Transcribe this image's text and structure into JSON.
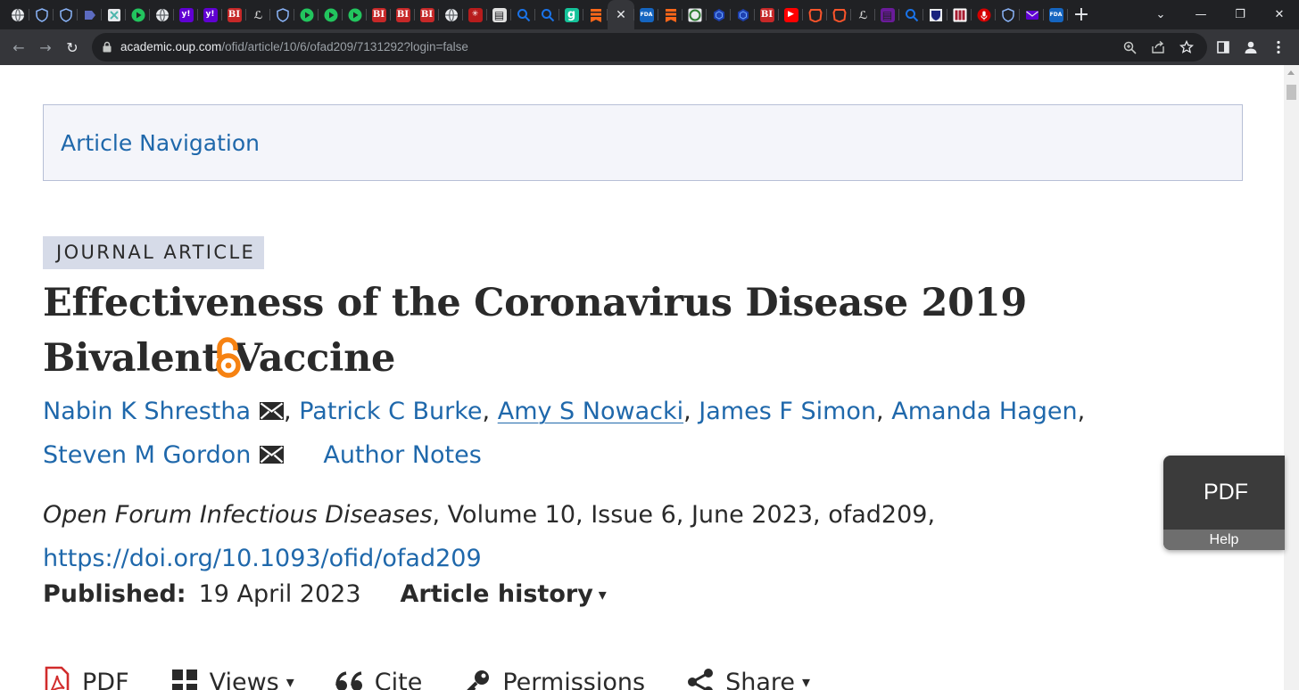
{
  "browser": {
    "tabs": [
      {
        "icon": "globe-icon",
        "label": "",
        "color": "#5f6368"
      },
      {
        "icon": "shield-icon",
        "label": "",
        "color": "#1a73e8"
      },
      {
        "icon": "shield-icon",
        "label": "",
        "color": "#1a73e8"
      },
      {
        "icon": "tag-icon",
        "label": "",
        "color": "#5c6bc0"
      },
      {
        "icon": "app-icon",
        "label": "",
        "color": "#4db6ac"
      },
      {
        "icon": "play-icon",
        "label": "",
        "color": "#22c55e"
      },
      {
        "icon": "globe-icon",
        "label": "",
        "color": "#5f6368"
      },
      {
        "icon": "yahoo-icon",
        "label": "y!",
        "color": "#6001d2"
      },
      {
        "icon": "yahoo-icon",
        "label": "y!",
        "color": "#6001d2"
      },
      {
        "icon": "bi-icon",
        "label": "BI",
        "color": "#c62828"
      },
      {
        "icon": "text-icon",
        "label": "ℒ",
        "color": "#444444"
      },
      {
        "icon": "shield-icon",
        "label": "",
        "color": "#1a73e8"
      },
      {
        "icon": "play-icon",
        "label": "",
        "color": "#22c55e"
      },
      {
        "icon": "play-icon",
        "label": "",
        "color": "#22c55e"
      },
      {
        "icon": "play-icon",
        "label": "",
        "color": "#22c55e"
      },
      {
        "icon": "bi-icon",
        "label": "BI",
        "color": "#c62828"
      },
      {
        "icon": "bi-icon",
        "label": "BI",
        "color": "#c62828"
      },
      {
        "icon": "bi-icon",
        "label": "BI",
        "color": "#c62828"
      },
      {
        "icon": "globe-icon",
        "label": "",
        "color": "#5f6368"
      },
      {
        "icon": "burst-icon",
        "label": "✳",
        "color": "#b71c1c"
      },
      {
        "icon": "news-icon",
        "label": "▤",
        "color": "#e0e0e0"
      },
      {
        "icon": "search-icon",
        "label": "",
        "color": "#1a73e8"
      },
      {
        "icon": "search-icon",
        "label": "",
        "color": "#1a73e8"
      },
      {
        "icon": "g-icon",
        "label": "g",
        "color": "#15c39a"
      },
      {
        "icon": "bookmark-icon",
        "label": "",
        "color": "#ff6719"
      },
      {
        "icon": "close-icon",
        "label": "✕",
        "color": "#e8eaed",
        "active": true
      },
      {
        "icon": "fda-icon",
        "label": "FDA",
        "color": "#1565c0"
      },
      {
        "icon": "bookmark-icon",
        "label": "",
        "color": "#ff6719"
      },
      {
        "icon": "seal-icon",
        "label": "",
        "color": "#2e7d32"
      },
      {
        "icon": "hex-icon",
        "label": "",
        "color": "#1e40af"
      },
      {
        "icon": "hex-icon",
        "label": "",
        "color": "#1e40af"
      },
      {
        "icon": "bi-icon",
        "label": "BI",
        "color": "#c62828"
      },
      {
        "icon": "youtube-icon",
        "label": "▶",
        "color": "#ff0000"
      },
      {
        "icon": "brave-icon",
        "label": "",
        "color": "#fb542b"
      },
      {
        "icon": "brave-icon",
        "label": "",
        "color": "#fb542b"
      },
      {
        "icon": "text-icon",
        "label": "ℒ",
        "color": "#444444"
      },
      {
        "icon": "news-icon",
        "label": "▤",
        "color": "#6a1b9a"
      },
      {
        "icon": "search-icon",
        "label": "",
        "color": "#1a73e8"
      },
      {
        "icon": "shield-crest-icon",
        "label": "",
        "color": "#1a237e"
      },
      {
        "icon": "harvard-icon",
        "label": "",
        "color": "#a51c30"
      },
      {
        "icon": "mic-icon",
        "label": "",
        "color": "#d50000"
      },
      {
        "icon": "shield-icon",
        "label": "",
        "color": "#1a73e8"
      },
      {
        "icon": "mail-icon",
        "label": "",
        "color": "#6001d2"
      },
      {
        "icon": "fda-icon",
        "label": "FDA",
        "color": "#1565c0"
      }
    ],
    "new_tab": "+",
    "window_controls": {
      "dropdown": "⌄",
      "minimize": "—",
      "restore": "❐",
      "close": "✕"
    },
    "back": "←",
    "forward": "→",
    "reload": "↻",
    "url_host": "academic.oup.com",
    "url_path": "/ofid/article/10/6/ofad209/7131292?login=false",
    "omni_icons": [
      "zoom-icon",
      "share-icon",
      "star-icon"
    ],
    "toolbar_icons": [
      "sidepanel-icon",
      "profile-icon",
      "menu-icon"
    ]
  },
  "article_nav": {
    "label": "Article Navigation"
  },
  "badge": "JOURNAL ARTICLE",
  "title": "Effectiveness of the Coronavirus Disease 2019 Bivalent Vaccine",
  "open_access_color": "#f68212",
  "authors": [
    {
      "name": "Nabin K Shrestha",
      "email": true,
      "underline": false
    },
    {
      "name": "Patrick C Burke",
      "email": false,
      "underline": false
    },
    {
      "name": "Amy S Nowacki",
      "email": false,
      "underline": true
    },
    {
      "name": "James F Simon",
      "email": false,
      "underline": false
    },
    {
      "name": "Amanda Hagen",
      "email": false,
      "underline": false
    },
    {
      "name": "Steven M Gordon",
      "email": true,
      "underline": false
    }
  ],
  "author_notes": "Author Notes",
  "citation": {
    "journal": "Open Forum Infectious Diseases",
    "details": ", Volume 10, Issue 6, June 2023, ofad209,",
    "doi": "https://doi.org/10.1093/ofid/ofad209"
  },
  "published": {
    "label": "Published:",
    "date": "19 April 2023",
    "history": "Article history",
    "caret": "▾"
  },
  "tools": [
    {
      "name": "pdf",
      "label": "PDF",
      "icon": "pdf-icon",
      "caret": ""
    },
    {
      "name": "views",
      "label": "Views",
      "icon": "grid-icon",
      "caret": "▾"
    },
    {
      "name": "cite",
      "label": "Cite",
      "icon": "quote-icon",
      "caret": ""
    },
    {
      "name": "permissions",
      "label": "Permissions",
      "icon": "key-icon",
      "caret": ""
    },
    {
      "name": "share",
      "label": "Share",
      "icon": "share-icon",
      "caret": "▾"
    }
  ],
  "pdf_widget": {
    "label": "PDF",
    "help": "Help"
  },
  "colors": {
    "link": "#1f68ab",
    "text": "#2a2a2a",
    "nav_bg": "#f4f5fa",
    "badge_bg": "#d6dbe8",
    "pdf_red": "#d12c2c"
  }
}
